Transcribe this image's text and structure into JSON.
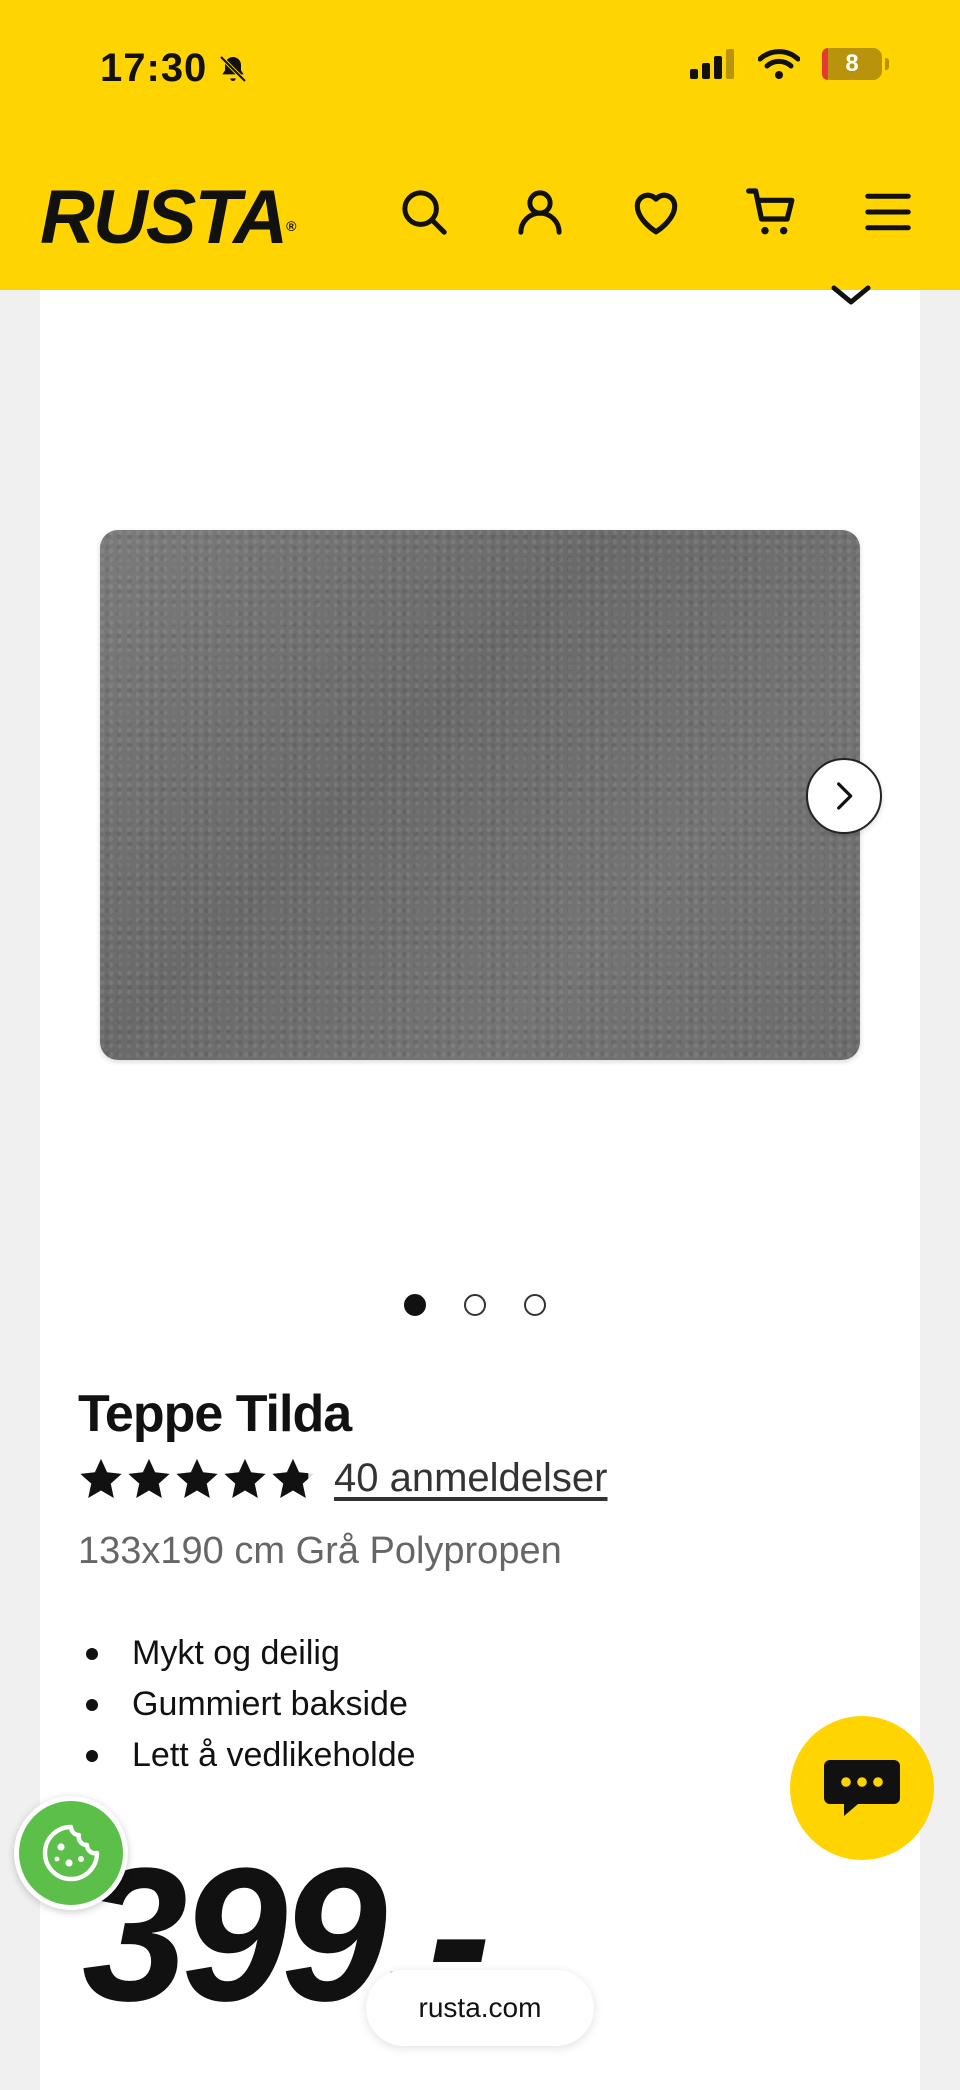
{
  "status_bar": {
    "time": "17:30",
    "battery": "8"
  },
  "brand": {
    "logo": "RUSTA",
    "registered": "®"
  },
  "nav": {
    "icons": [
      "search-icon",
      "account-icon",
      "heart-icon",
      "cart-icon",
      "menu-icon"
    ]
  },
  "carousel": {
    "total_images": 3,
    "active_index": 1
  },
  "product": {
    "title": "Teppe Tilda",
    "rating": 4.9,
    "reviews": "40 anmeldelser",
    "subtitle": "133x190 cm Grå Polypropen",
    "bullets": [
      "Mykt og deilig",
      "Gummiert bakside",
      "Lett å vedlikeholde"
    ],
    "price": "399,-"
  },
  "browser": {
    "url": "rusta.com"
  },
  "colors": {
    "brand_yellow": "#ffd400",
    "cookie_green": "#5cbf4a"
  }
}
